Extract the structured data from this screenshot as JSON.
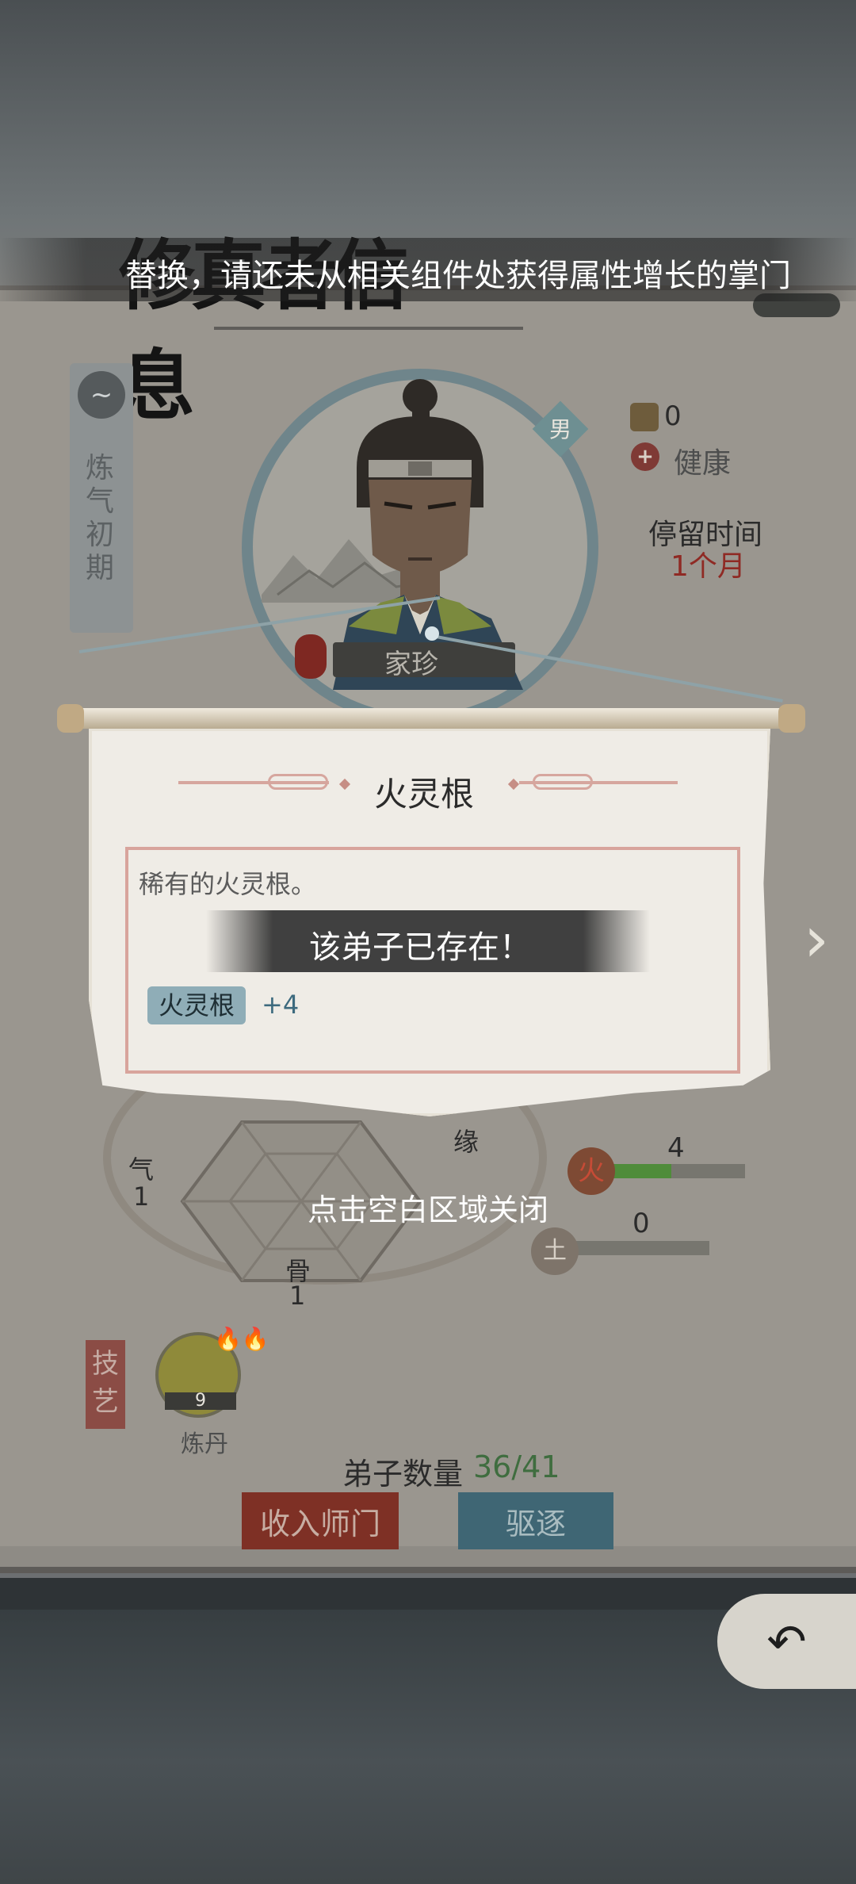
{
  "toast": {
    "text": "替换，请还未从相关组件处获得属性增长的掌门"
  },
  "title": {
    "text": "修真者信息"
  },
  "rank": {
    "label": "炼气初期",
    "icon": "rank-swirl-icon"
  },
  "portrait": {
    "gender": "男"
  },
  "stats": {
    "coin_value": "0",
    "health_label": "健康",
    "stay_label": "停留时间",
    "stay_value": "1个月"
  },
  "name": "家珍",
  "attributes": {
    "qi_label": "气",
    "qi_value": "1",
    "gu_label": "骨",
    "gu_value": "1",
    "yuan_label": "缘"
  },
  "elements": {
    "fire": {
      "icon_label": "火",
      "value": "4",
      "fill": 0.45,
      "color": "#4f8c3a"
    },
    "earth": {
      "icon_label": "土",
      "value": "0",
      "fill": 0
    }
  },
  "skills": {
    "tag": "技艺",
    "items": [
      {
        "name": "炼丹",
        "level": "9"
      }
    ]
  },
  "disciples": {
    "label": "弟子数量",
    "value": "36/41"
  },
  "buttons": {
    "accept": "收入师门",
    "expel": "驱逐"
  },
  "modal": {
    "title": "火灵根",
    "description": "稀有的火灵根。",
    "exists_text": "该弟子已存在！",
    "attr_tag": "火灵根",
    "attr_value": "+4"
  },
  "close_hint": "点击空白区域关闭",
  "back_icon": "back-arrow-icon",
  "next_icon": "chevron-right-icon"
}
